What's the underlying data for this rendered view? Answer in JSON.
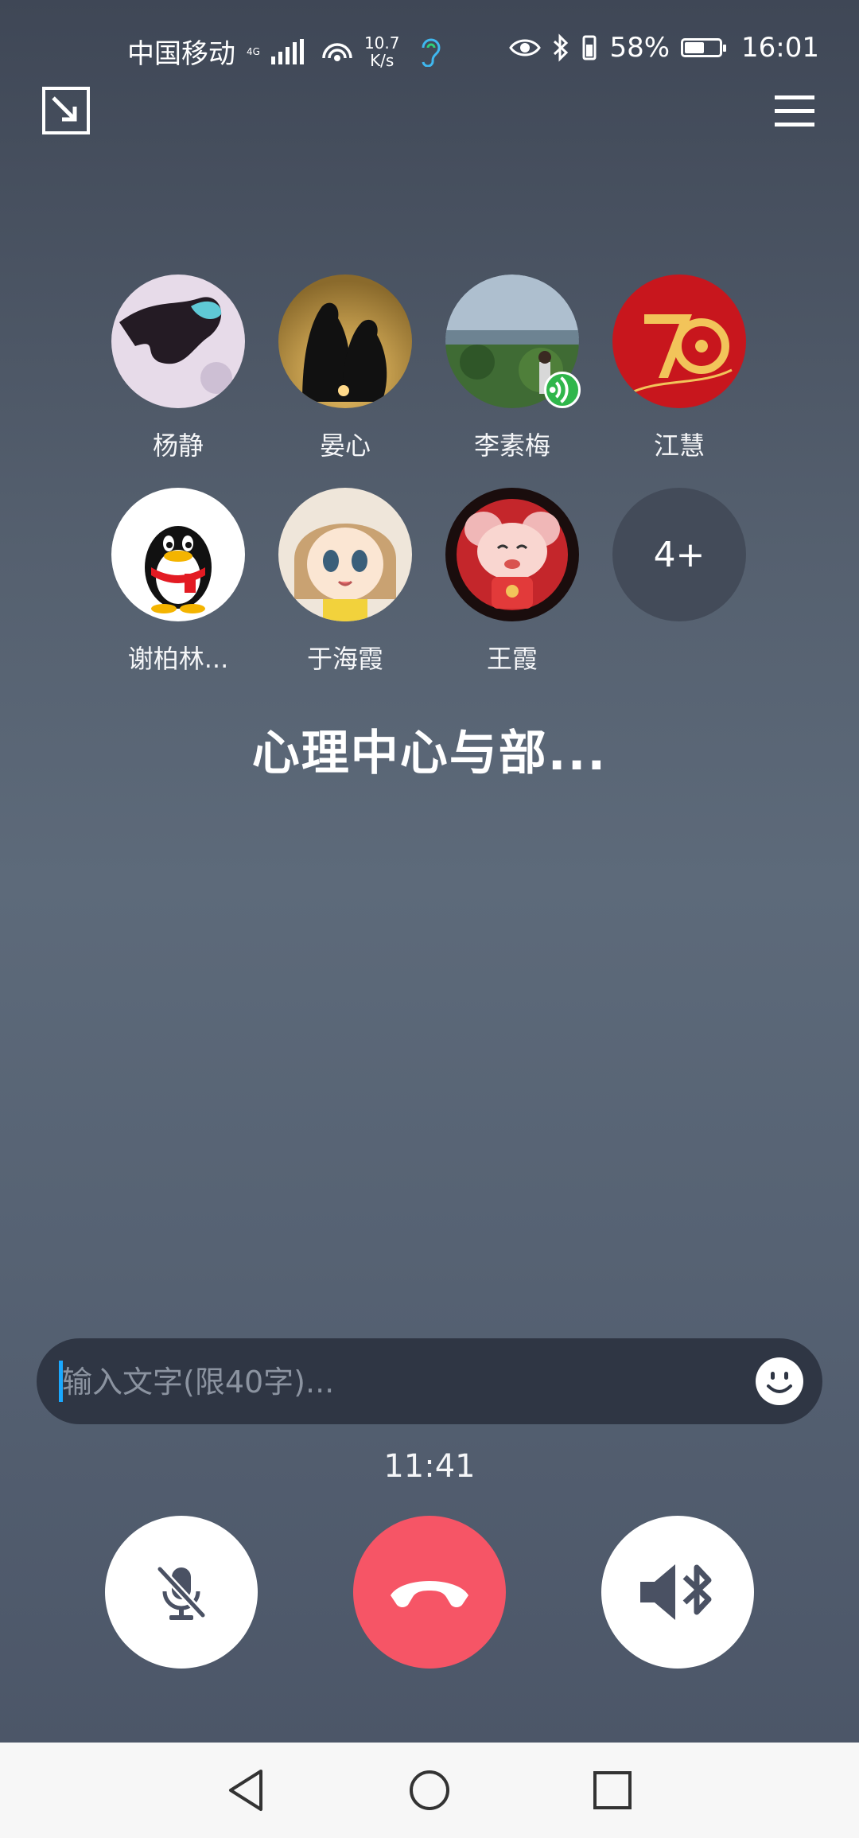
{
  "status_bar": {
    "carrier": "中国移动",
    "network": "4G",
    "speed": "10.7",
    "speed_unit": "K/s",
    "battery_percent": "58%",
    "battery_level": 0.58,
    "time": "16:01",
    "icons": [
      "signal-icon",
      "wifi-hotspot-icon",
      "hearing-icon",
      "eye-icon",
      "bluetooth-icon",
      "vibrate-icon",
      "battery-icon"
    ]
  },
  "header": {
    "minimize_icon": "minimize-icon",
    "menu_icon": "menu-icon"
  },
  "participants": [
    {
      "name": "杨静",
      "avatar": "photo-dark-feather"
    },
    {
      "name": "晏心",
      "avatar": "penguin-silhouettes"
    },
    {
      "name": "李素梅",
      "avatar": "landscape-person",
      "speaking": true
    },
    {
      "name": "江慧",
      "avatar": "red-70-anniversary"
    },
    {
      "name": "谢柏林...",
      "avatar": "qq-penguin"
    },
    {
      "name": "于海霞",
      "avatar": "anime-girl"
    },
    {
      "name": "王霞",
      "avatar": "cartoon-mouse"
    },
    {
      "name": "",
      "more_label": "4+"
    }
  ],
  "group_title": "心理中心与部...",
  "chat_input": {
    "placeholder": "输入文字(限40字)...",
    "value": ""
  },
  "timer": "11:41",
  "controls": {
    "mute": "mic-off-icon",
    "hangup": "hang-up-icon",
    "speaker": "bluetooth-speaker-icon"
  },
  "colors": {
    "hangup": "#f65566",
    "speaking_badge": "#2fb64b",
    "accent_caret": "#1aa8ff"
  },
  "nav": [
    "back-icon",
    "home-icon",
    "recents-icon"
  ]
}
